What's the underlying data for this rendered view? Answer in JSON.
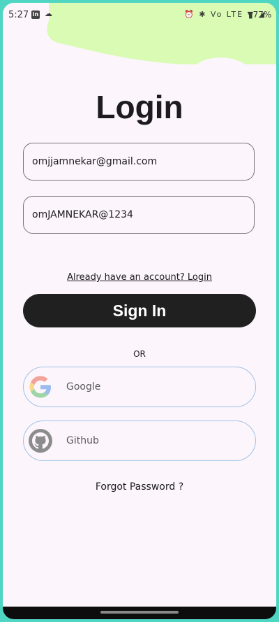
{
  "status_bar": {
    "time": "5:27",
    "linkedin_glyph": "in",
    "cloud_glyph": "☁",
    "icons_text": "⏰ ✱ Vo LTE ▼ ◢",
    "battery": "▮77%"
  },
  "header": {
    "title": "Login"
  },
  "form": {
    "email_value": "omjjamnekar@gmail.com",
    "password_value": "omJAMNEKAR@1234"
  },
  "already_account_link": "Already have an account? Login",
  "sign_in_button": "Sign In",
  "divider_text": "OR",
  "social": [
    {
      "label": "Google",
      "icon": "google-logo-icon"
    },
    {
      "label": "Github",
      "icon": "github-logo-icon"
    }
  ],
  "forgot_password_link": "Forgot Password ?",
  "colors": {
    "frame_border": "#4fd6c3",
    "background": "#fcf5fc",
    "blob": "#d9fbb4",
    "button": "#202020",
    "social_border": "#9fc3e6"
  }
}
